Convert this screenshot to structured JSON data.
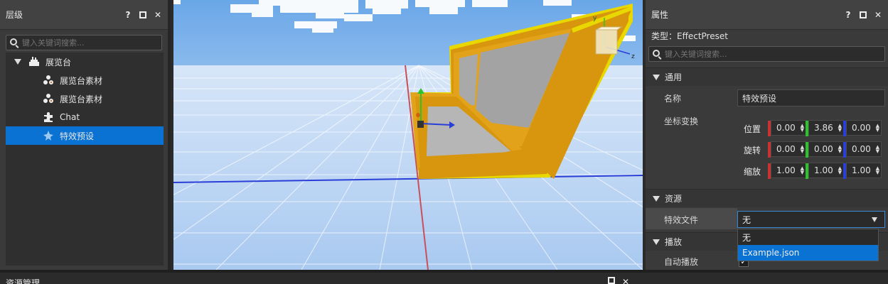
{
  "hierarchy": {
    "title": "层级",
    "help": "?",
    "close": "✕",
    "search_placeholder": "键入关键词搜索...",
    "items": [
      {
        "label": "展览台",
        "icon": "display-stand-icon",
        "expanded": true
      },
      {
        "label": "展览台素材",
        "icon": "material-icon"
      },
      {
        "label": "展览台素材",
        "icon": "material-icon"
      },
      {
        "label": "Chat",
        "icon": "puzzle-icon"
      },
      {
        "label": "特效预设",
        "icon": "effect-icon",
        "selected": true
      }
    ]
  },
  "viewport": {
    "gizmo_axes": {
      "y": "y",
      "z": "z"
    }
  },
  "properties": {
    "title": "属性",
    "help": "?",
    "close": "✕",
    "type_line": "类型：EffectPreset",
    "search_placeholder": "键入关键词搜索...",
    "sections": {
      "general": "通用",
      "resources": "资源",
      "playback": "播放"
    },
    "name_label": "名称",
    "name_value": "特效预设",
    "transform_label": "坐标变换",
    "position": {
      "label": "位置",
      "x": "0.00",
      "y": "3.86",
      "z": "0.00"
    },
    "rotation": {
      "label": "旋转",
      "x": "0.00",
      "y": "0.00",
      "z": "0.00"
    },
    "scale": {
      "label": "缩放",
      "x": "1.00",
      "y": "1.00",
      "z": "1.00"
    },
    "effect_file_label": "特效文件",
    "effect_file_value": "无",
    "effect_file_options": [
      "无",
      "Example.json"
    ],
    "autoplay_label": "自动播放",
    "autoplay_checked": true
  },
  "bottom": {
    "title": "资源管理"
  },
  "colors": {
    "selection": "#0a72d3",
    "axis_x": "#c83232",
    "axis_y": "#2bc42b",
    "axis_z": "#2a3ed8"
  }
}
